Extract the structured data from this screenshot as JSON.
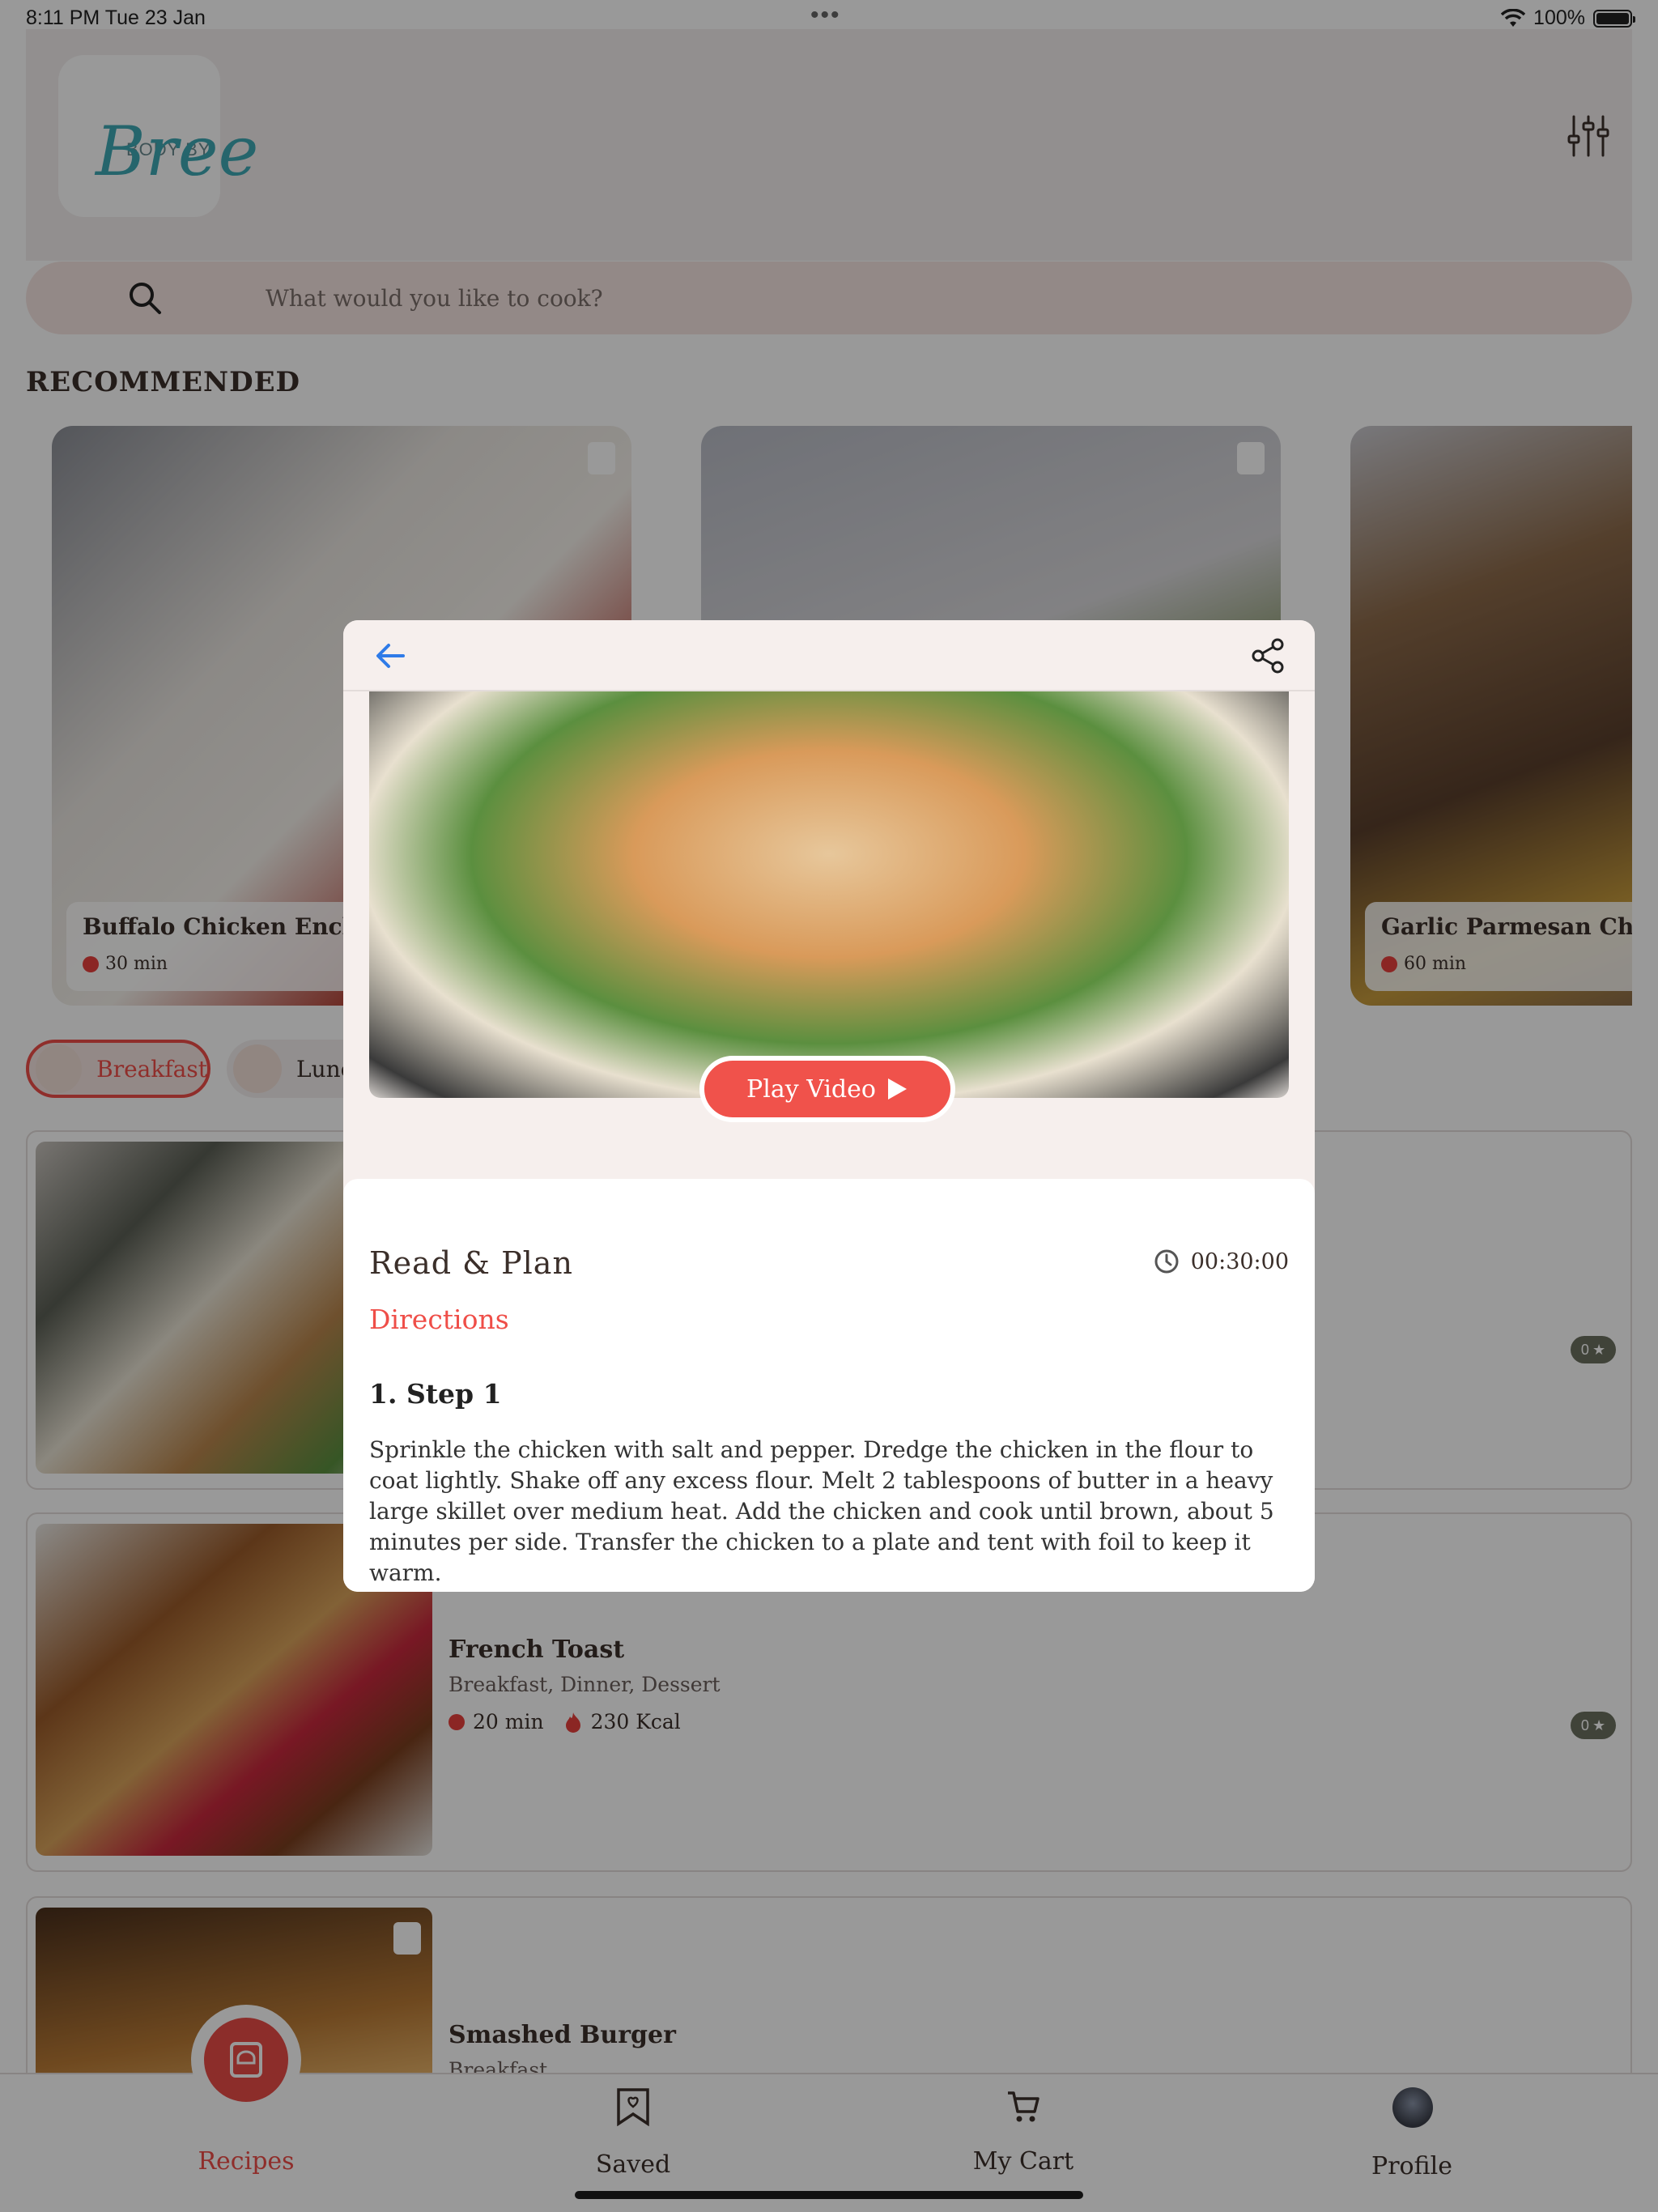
{
  "status": {
    "time": "8:11 PM  Tue 23 Jan",
    "battery": "100%",
    "dots": "•••"
  },
  "header": {
    "logo_small": "BODY BY",
    "logo_script": "Bree"
  },
  "search": {
    "placeholder": "What would you like to cook?"
  },
  "recommended": {
    "title": "RECOMMENDED",
    "cards": [
      {
        "title": "Buffalo Chicken Enchiladas",
        "time": "30 min"
      },
      {
        "title": "",
        "time": ""
      },
      {
        "title": "Garlic Parmesan Chicken",
        "time": "60 min"
      }
    ]
  },
  "categories": [
    {
      "label": "Breakfast",
      "active": true
    },
    {
      "label": "Lunch",
      "active": false
    }
  ],
  "recipes": [
    {
      "title": "",
      "categories": "",
      "time": "",
      "kcal": "",
      "rating": "0"
    },
    {
      "title": "French Toast",
      "categories": "Breakfast, Dinner, Dessert",
      "time": "20 min",
      "kcal": "230 Kcal",
      "rating": "0"
    },
    {
      "title": "Smashed Burger",
      "categories": "Breakfast",
      "time": "",
      "kcal": "",
      "rating": ""
    }
  ],
  "tabs": {
    "recipes": "Recipes",
    "saved": "Saved",
    "cart": "My Cart",
    "profile": "Profile"
  },
  "modal": {
    "play_label": "Play Video",
    "section_title": "Read & Plan",
    "duration": "00:30:00",
    "directions_label": "Directions",
    "step_title": "1. Step 1",
    "step_text": "Sprinkle the chicken with salt and pepper. Dredge the chicken in the flour to coat lightly. Shake off any excess flour. Melt 2 tablespoons of butter in a heavy large skillet over medium heat. Add the chicken and cook until brown, about 5 minutes per side. Transfer the chicken to a plate and tent with foil to keep it warm."
  },
  "colors": {
    "accent": "#ef4e48",
    "search_bg": "#f6e4e2",
    "rating_bg": "#6b7060"
  },
  "icons": {
    "back": "arrow-left-icon",
    "share": "share-icon",
    "search": "search-icon",
    "filter": "sliders-icon",
    "bookmark": "bookmark-icon",
    "clock": "clock-icon",
    "flame": "flame-icon",
    "cart": "cart-icon",
    "recipes": "recipe-book-icon",
    "profile": "avatar"
  }
}
